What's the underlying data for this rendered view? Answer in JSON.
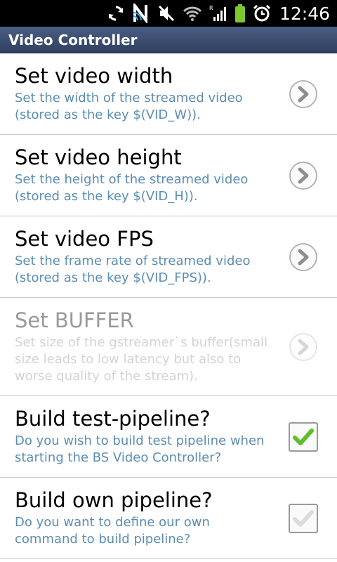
{
  "status_bar": {
    "time": "12:46",
    "icons": [
      "sync-icon",
      "nfc-icon",
      "mute-icon",
      "wifi-icon",
      "signal-icon",
      "battery-icon",
      "alarm-icon"
    ]
  },
  "app": {
    "title": "Video Controller"
  },
  "preferences": [
    {
      "title": "Set video width",
      "summary": "Set the width of the streamed video (stored as the key $(VID_W)).",
      "widget": "chevron-right-icon",
      "enabled": true
    },
    {
      "title": "Set video height",
      "summary": "Set the height of the streamed video (stored as the key $(VID_H)).",
      "widget": "chevron-right-icon",
      "enabled": true
    },
    {
      "title": "Set video FPS",
      "summary": "Set the frame rate of streamed video (stored as the key $(VID_FPS)).",
      "widget": "chevron-right-icon",
      "enabled": true
    },
    {
      "title": "Set BUFFER",
      "summary": "Set size of the gstreamer`s buffer(small size leads to low latency but also to worse quality of the stream).",
      "widget": "chevron-right-icon",
      "enabled": false
    },
    {
      "title": "Build test-pipeline?",
      "summary": "Do you wish to build test pipeline when starting the BS Video Controller?",
      "widget": "checkbox",
      "checked": true,
      "enabled": true
    },
    {
      "title": "Build own pipeline?",
      "summary": "Do you want to define our own command to build pipeline?",
      "widget": "checkbox",
      "checked": false,
      "enabled": true
    }
  ],
  "colors": {
    "summary": "#5b8db3",
    "title_bar": "#3b4d70",
    "check_green": "#5fbf2a"
  }
}
